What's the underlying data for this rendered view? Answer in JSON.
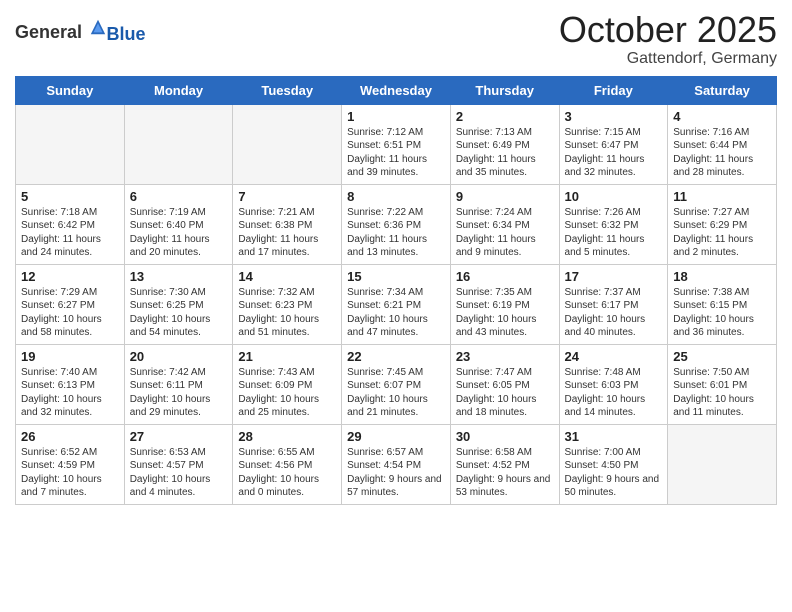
{
  "header": {
    "logo_general": "General",
    "logo_blue": "Blue",
    "month": "October 2025",
    "location": "Gattendorf, Germany"
  },
  "days_of_week": [
    "Sunday",
    "Monday",
    "Tuesday",
    "Wednesday",
    "Thursday",
    "Friday",
    "Saturday"
  ],
  "weeks": [
    [
      {
        "day": null,
        "text": null
      },
      {
        "day": null,
        "text": null
      },
      {
        "day": null,
        "text": null
      },
      {
        "day": "1",
        "text": "Sunrise: 7:12 AM\nSunset: 6:51 PM\nDaylight: 11 hours\nand 39 minutes."
      },
      {
        "day": "2",
        "text": "Sunrise: 7:13 AM\nSunset: 6:49 PM\nDaylight: 11 hours\nand 35 minutes."
      },
      {
        "day": "3",
        "text": "Sunrise: 7:15 AM\nSunset: 6:47 PM\nDaylight: 11 hours\nand 32 minutes."
      },
      {
        "day": "4",
        "text": "Sunrise: 7:16 AM\nSunset: 6:44 PM\nDaylight: 11 hours\nand 28 minutes."
      }
    ],
    [
      {
        "day": "5",
        "text": "Sunrise: 7:18 AM\nSunset: 6:42 PM\nDaylight: 11 hours\nand 24 minutes."
      },
      {
        "day": "6",
        "text": "Sunrise: 7:19 AM\nSunset: 6:40 PM\nDaylight: 11 hours\nand 20 minutes."
      },
      {
        "day": "7",
        "text": "Sunrise: 7:21 AM\nSunset: 6:38 PM\nDaylight: 11 hours\nand 17 minutes."
      },
      {
        "day": "8",
        "text": "Sunrise: 7:22 AM\nSunset: 6:36 PM\nDaylight: 11 hours\nand 13 minutes."
      },
      {
        "day": "9",
        "text": "Sunrise: 7:24 AM\nSunset: 6:34 PM\nDaylight: 11 hours\nand 9 minutes."
      },
      {
        "day": "10",
        "text": "Sunrise: 7:26 AM\nSunset: 6:32 PM\nDaylight: 11 hours\nand 5 minutes."
      },
      {
        "day": "11",
        "text": "Sunrise: 7:27 AM\nSunset: 6:29 PM\nDaylight: 11 hours\nand 2 minutes."
      }
    ],
    [
      {
        "day": "12",
        "text": "Sunrise: 7:29 AM\nSunset: 6:27 PM\nDaylight: 10 hours\nand 58 minutes."
      },
      {
        "day": "13",
        "text": "Sunrise: 7:30 AM\nSunset: 6:25 PM\nDaylight: 10 hours\nand 54 minutes."
      },
      {
        "day": "14",
        "text": "Sunrise: 7:32 AM\nSunset: 6:23 PM\nDaylight: 10 hours\nand 51 minutes."
      },
      {
        "day": "15",
        "text": "Sunrise: 7:34 AM\nSunset: 6:21 PM\nDaylight: 10 hours\nand 47 minutes."
      },
      {
        "day": "16",
        "text": "Sunrise: 7:35 AM\nSunset: 6:19 PM\nDaylight: 10 hours\nand 43 minutes."
      },
      {
        "day": "17",
        "text": "Sunrise: 7:37 AM\nSunset: 6:17 PM\nDaylight: 10 hours\nand 40 minutes."
      },
      {
        "day": "18",
        "text": "Sunrise: 7:38 AM\nSunset: 6:15 PM\nDaylight: 10 hours\nand 36 minutes."
      }
    ],
    [
      {
        "day": "19",
        "text": "Sunrise: 7:40 AM\nSunset: 6:13 PM\nDaylight: 10 hours\nand 32 minutes."
      },
      {
        "day": "20",
        "text": "Sunrise: 7:42 AM\nSunset: 6:11 PM\nDaylight: 10 hours\nand 29 minutes."
      },
      {
        "day": "21",
        "text": "Sunrise: 7:43 AM\nSunset: 6:09 PM\nDaylight: 10 hours\nand 25 minutes."
      },
      {
        "day": "22",
        "text": "Sunrise: 7:45 AM\nSunset: 6:07 PM\nDaylight: 10 hours\nand 21 minutes."
      },
      {
        "day": "23",
        "text": "Sunrise: 7:47 AM\nSunset: 6:05 PM\nDaylight: 10 hours\nand 18 minutes."
      },
      {
        "day": "24",
        "text": "Sunrise: 7:48 AM\nSunset: 6:03 PM\nDaylight: 10 hours\nand 14 minutes."
      },
      {
        "day": "25",
        "text": "Sunrise: 7:50 AM\nSunset: 6:01 PM\nDaylight: 10 hours\nand 11 minutes."
      }
    ],
    [
      {
        "day": "26",
        "text": "Sunrise: 6:52 AM\nSunset: 4:59 PM\nDaylight: 10 hours\nand 7 minutes."
      },
      {
        "day": "27",
        "text": "Sunrise: 6:53 AM\nSunset: 4:57 PM\nDaylight: 10 hours\nand 4 minutes."
      },
      {
        "day": "28",
        "text": "Sunrise: 6:55 AM\nSunset: 4:56 PM\nDaylight: 10 hours\nand 0 minutes."
      },
      {
        "day": "29",
        "text": "Sunrise: 6:57 AM\nSunset: 4:54 PM\nDaylight: 9 hours\nand 57 minutes."
      },
      {
        "day": "30",
        "text": "Sunrise: 6:58 AM\nSunset: 4:52 PM\nDaylight: 9 hours\nand 53 minutes."
      },
      {
        "day": "31",
        "text": "Sunrise: 7:00 AM\nSunset: 4:50 PM\nDaylight: 9 hours\nand 50 minutes."
      },
      {
        "day": null,
        "text": null
      }
    ]
  ]
}
